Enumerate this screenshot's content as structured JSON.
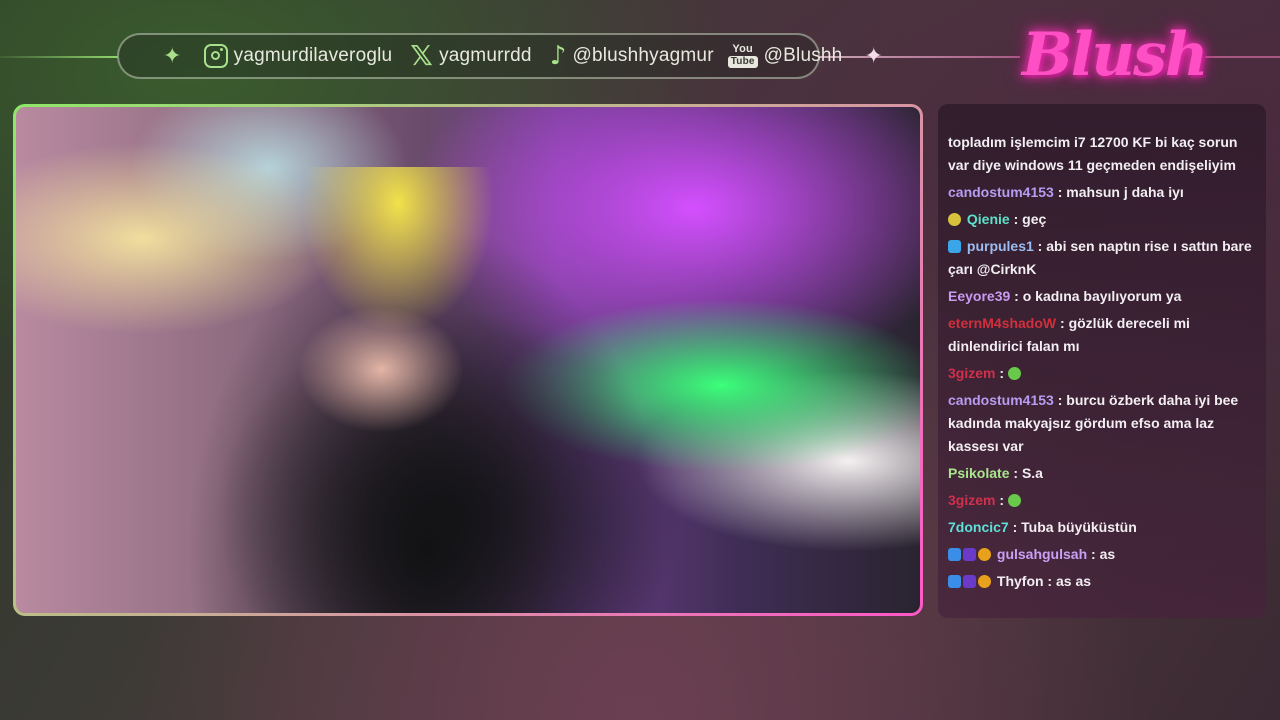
{
  "socials": {
    "instagram": "yagmurdilaveroglu",
    "x": "yagmurrdd",
    "tiktok": "@blushhyagmur",
    "youtube_icon_top": "You",
    "youtube_icon_bottom": "Tube",
    "youtube": "@Blushh"
  },
  "logo_text": "Blush",
  "colors": {
    "accent_green": "#a8e08c",
    "accent_pink": "#ff4fc4"
  },
  "chat": {
    "messages": [
      {
        "user": "",
        "color": "#f2eef2",
        "text": "topladım işlemcim i7 12700 KF bi kaç sorun var diye windows 11 geçmeden endişeliyim",
        "badges": []
      },
      {
        "user": "candostum4153",
        "color": "#b79cf0",
        "text": "mahsun j daha iyı",
        "badges": []
      },
      {
        "user": "Qienie",
        "color": "#5de0c9",
        "text": "geç",
        "badges": [
          "#d8c23c"
        ]
      },
      {
        "user": "purpules1",
        "color": "#9bbcf0",
        "text": "abi sen naptın rise ı sattın bare çarı @CirknK",
        "badges": [
          "#3aa6e8"
        ]
      },
      {
        "user": "Eeyore39",
        "color": "#c89af0",
        "text": "o kadına bayılıyorum ya",
        "badges": []
      },
      {
        "user": "eternM4shadoW",
        "color": "#d0303c",
        "text": "gözlük dereceli mi dinlendirici falan mı",
        "badges": []
      },
      {
        "user": "3gizem",
        "color": "#d0304c",
        "text": "",
        "badges": [],
        "emote": true
      },
      {
        "user": "candostum4153",
        "color": "#b79cf0",
        "text": "burcu özberk daha iyi bee kadında makyajsız gördum efso ama laz kassesı var",
        "badges": []
      },
      {
        "user": "Psikolate",
        "color": "#a8e68c",
        "text": "S.a",
        "badges": []
      },
      {
        "user": "3gizem",
        "color": "#d0304c",
        "text": "",
        "badges": [],
        "emote": true
      },
      {
        "user": "7doncic7",
        "color": "#5de0d8",
        "text": "Tuba büyüküstün",
        "badges": []
      },
      {
        "user": "gulsahgulsah",
        "color": "#c9a0f5",
        "text": "as",
        "badges": [
          "#3a8ee8",
          "#6a3ac8",
          "#e8a11a"
        ]
      },
      {
        "user": "Thyfon",
        "color": "#f2eef2",
        "text": "as as",
        "badges": [
          "#3a8ee8",
          "#6a3ac8",
          "#e8a11a"
        ]
      }
    ]
  }
}
